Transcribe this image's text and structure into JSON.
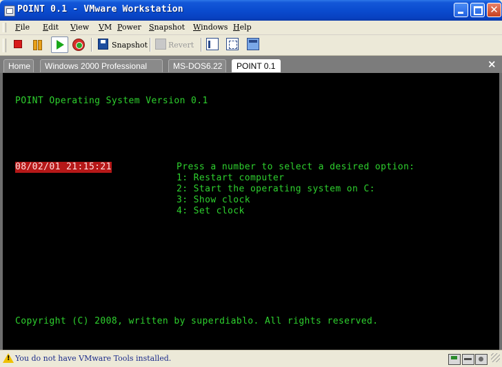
{
  "window": {
    "title": "POINT 0.1 - VMware Workstation",
    "close_glyph": "✕"
  },
  "menu": [
    "File",
    "Edit",
    "View",
    "VM",
    "Power",
    "Snapshot",
    "Windows",
    "Help"
  ],
  "toolbar": {
    "snapshot_label": "Snapshot",
    "revert_label": "Revert"
  },
  "tabs": [
    {
      "label": "Home",
      "active": false
    },
    {
      "label": "Windows 2000 Professional",
      "active": false
    },
    {
      "label": "MS-DOS6.22",
      "active": false
    },
    {
      "label": "POINT 0.1",
      "active": true
    }
  ],
  "tab_close_glyph": "×",
  "console": {
    "heading": "POINT Operating System Version 0.1",
    "clock": "08/02/01 21:15:21",
    "prompt": "Press a number to select a desired option:",
    "options": [
      "1: Restart computer",
      "2: Start the operating system on C:",
      "3: Show clock",
      "4: Set clock"
    ],
    "copyright": "Copyright (C) 2008, written by superdiablo. All rights reserved.",
    "text_color": "#2ED12E",
    "clock_bg": "#B51818"
  },
  "status": {
    "message": "You do not have VMware Tools installed."
  },
  "icons": {
    "stop": "stop-icon",
    "pause": "pause-icon",
    "play": "play-icon",
    "reset": "reset-icon",
    "snapshot": "save-icon",
    "revert": "revert-icon",
    "warning": "warning-icon"
  }
}
